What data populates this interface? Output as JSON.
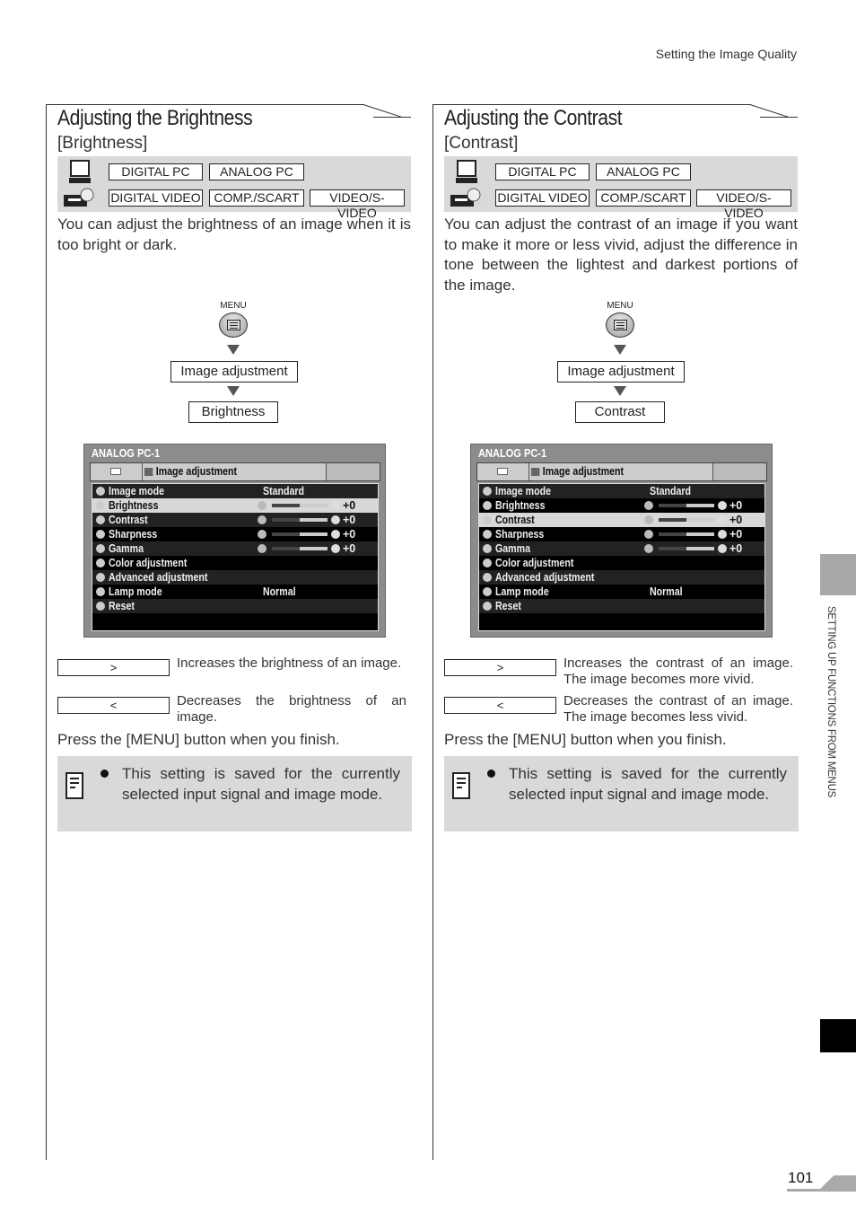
{
  "running_header": "Setting the Image Quality",
  "side_tab_text": "SETTING UP FUNCTIONS FROM MENUS",
  "page_number": "101",
  "sections": [
    {
      "title": "Adjusting the Brightness",
      "subtitle": "[Brightness]",
      "signals_row1": [
        "DIGITAL PC",
        "ANALOG PC"
      ],
      "signals_row2": [
        "DIGITAL VIDEO",
        "COMP./SCART",
        "VIDEO/S-VIDEO"
      ],
      "description": "You can adjust the brightness of an image when it is too bright or dark.",
      "flow": {
        "menu_label": "MENU",
        "step1": "Image adjustment",
        "step2": "Brightness"
      },
      "osd": {
        "source": "ANALOG PC-1",
        "tab": "Image adjustment",
        "selected": "Brightness",
        "rows": [
          {
            "label": "Image mode",
            "value": "Standard"
          },
          {
            "label": "Brightness",
            "value": "+0",
            "level": 0.5
          },
          {
            "label": "Contrast",
            "value": "+0",
            "level": 0.5
          },
          {
            "label": "Sharpness",
            "value": "+0",
            "level": 0.5
          },
          {
            "label": "Gamma",
            "value": "+0",
            "level": 0.5
          },
          {
            "label": "Color adjustment",
            "value": ""
          },
          {
            "label": "Advanced adjustment",
            "value": ""
          },
          {
            "label": "Lamp mode",
            "value": "Normal"
          },
          {
            "label": "Reset",
            "value": ""
          }
        ]
      },
      "keys": [
        {
          "key": ">",
          "desc": "Increases the brightness of an image."
        },
        {
          "key": "<",
          "desc": "Decreases the brightness of an image."
        }
      ],
      "press": "Press the [MENU] button when you finish.",
      "note": "This setting is saved for the currently selected input signal and image mode."
    },
    {
      "title": "Adjusting the Contrast",
      "subtitle": "[Contrast]",
      "signals_row1": [
        "DIGITAL PC",
        "ANALOG PC"
      ],
      "signals_row2": [
        "DIGITAL VIDEO",
        "COMP./SCART",
        "VIDEO/S-VIDEO"
      ],
      "description": "You can adjust the contrast of an image if you want to make it more or less vivid, adjust the difference in tone between the lightest and darkest portions of the image.",
      "flow": {
        "menu_label": "MENU",
        "step1": "Image adjustment",
        "step2": "Contrast"
      },
      "osd": {
        "source": "ANALOG PC-1",
        "tab": "Image adjustment",
        "selected": "Contrast",
        "rows": [
          {
            "label": "Image mode",
            "value": "Standard"
          },
          {
            "label": "Brightness",
            "value": "+0",
            "level": 0.5
          },
          {
            "label": "Contrast",
            "value": "+0",
            "level": 0.5
          },
          {
            "label": "Sharpness",
            "value": "+0",
            "level": 0.5
          },
          {
            "label": "Gamma",
            "value": "+0",
            "level": 0.5
          },
          {
            "label": "Color adjustment",
            "value": ""
          },
          {
            "label": "Advanced adjustment",
            "value": ""
          },
          {
            "label": "Lamp mode",
            "value": "Normal"
          },
          {
            "label": "Reset",
            "value": ""
          }
        ]
      },
      "keys": [
        {
          "key": ">",
          "desc": "Increases the contrast of an image. The image becomes more vivid."
        },
        {
          "key": "<",
          "desc": "Decreases the contrast of an image. The image becomes less vivid."
        }
      ],
      "press": "Press the [MENU] button when you finish.",
      "note": "This setting is saved for the currently selected input signal and image mode."
    }
  ]
}
